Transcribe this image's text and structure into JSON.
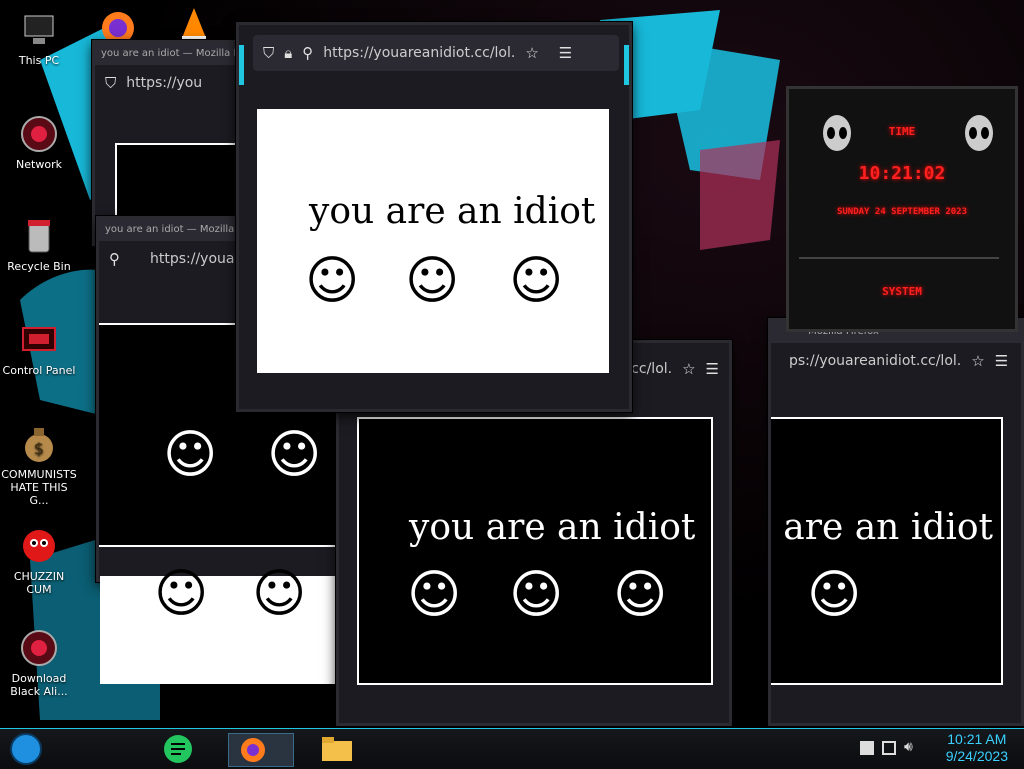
{
  "desktop": {
    "icons": [
      {
        "label": "This PC",
        "icon": "computer-icon"
      },
      {
        "label": "Network",
        "icon": "network-icon"
      },
      {
        "label": "Recycle Bin",
        "icon": "recycle-bin-icon"
      },
      {
        "label": "Control Panel",
        "icon": "control-panel-icon"
      },
      {
        "label": "COMMUNISTS HATE THIS G...",
        "icon": "money-bag-icon"
      },
      {
        "label": "CHUZZIN CUM",
        "icon": "red-fuzzball-icon"
      },
      {
        "label": "Download Black Ali...",
        "icon": "alienware-icon"
      }
    ]
  },
  "windows": {
    "front": {
      "url": "https://youareanidiot.cc/lol.",
      "message": "you are an idiot",
      "smileys": [
        "☺",
        "☺",
        "☺"
      ]
    },
    "middle": {
      "url": "idiot.cc/lol.",
      "message": "you are an idiot",
      "smileys": [
        "☺",
        "☺",
        "☺"
      ]
    },
    "right": {
      "title": "— Mozilla Firefox",
      "url": "ps://youareanidiot.cc/lol.",
      "message": "ou are an idiot",
      "smileys": [
        "☺"
      ]
    },
    "left_back": {
      "title": "you are an idiot — Mozilla Firefox",
      "url": "https://you"
    },
    "left_back2": {
      "url": "https://youa",
      "title": "you are an idiot — Mozilla"
    }
  },
  "widget": {
    "title": "TIME",
    "time": "10:21:02",
    "date": "SUNDAY 24 SEPTEMBER 2023",
    "button": "SYSTEM"
  },
  "taskbar": {
    "items": [
      "start-orb",
      "notes-app-icon",
      "firefox-icon",
      "file-explorer-icon"
    ],
    "clock_time": "10:21 AM",
    "clock_date": "9/24/2023"
  },
  "colors": {
    "accent": "#1fc8e0",
    "widget_red": "#ff2020",
    "wallpaper_cyan": "#18b8d8"
  }
}
